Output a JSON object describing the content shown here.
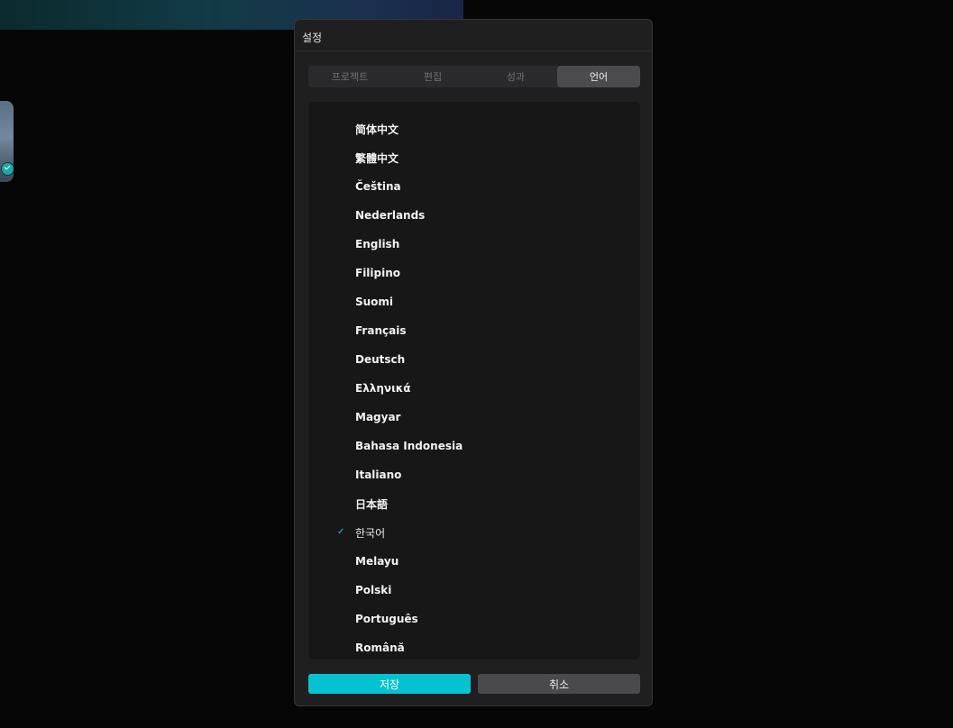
{
  "background": {
    "banner_colors": [
      "#0b2a2c",
      "#1b2f4e"
    ],
    "thumbnail_check_icon": "check-circle-icon"
  },
  "dialog": {
    "title": "설정",
    "tabs": [
      {
        "label": "프로젝트",
        "active": false
      },
      {
        "label": "편집",
        "active": false
      },
      {
        "label": "성과",
        "active": false
      },
      {
        "label": "언어",
        "active": true
      }
    ],
    "languages": [
      {
        "label": "简体中文",
        "selected": false
      },
      {
        "label": "繁體中文",
        "selected": false
      },
      {
        "label": "Čeština",
        "selected": false
      },
      {
        "label": "Nederlands",
        "selected": false
      },
      {
        "label": "English",
        "selected": false
      },
      {
        "label": "Filipino",
        "selected": false
      },
      {
        "label": "Suomi",
        "selected": false
      },
      {
        "label": "Français",
        "selected": false
      },
      {
        "label": "Deutsch",
        "selected": false
      },
      {
        "label": "Ελληνικά",
        "selected": false
      },
      {
        "label": "Magyar",
        "selected": false
      },
      {
        "label": "Bahasa Indonesia",
        "selected": false
      },
      {
        "label": "Italiano",
        "selected": false
      },
      {
        "label": "日本語",
        "selected": false
      },
      {
        "label": "한국어",
        "selected": true
      },
      {
        "label": "Melayu",
        "selected": false
      },
      {
        "label": "Polski",
        "selected": false
      },
      {
        "label": "Português",
        "selected": false
      },
      {
        "label": "Română",
        "selected": false
      }
    ],
    "check_icon": "check-icon",
    "save_label": "저장",
    "cancel_label": "취소"
  },
  "colors": {
    "accent": "#05c2d2",
    "dialog_bg": "#1f1f20",
    "panel_bg": "#171718",
    "tab_active_bg": "#4b4b4e",
    "cancel_bg": "#4a4a4d"
  }
}
